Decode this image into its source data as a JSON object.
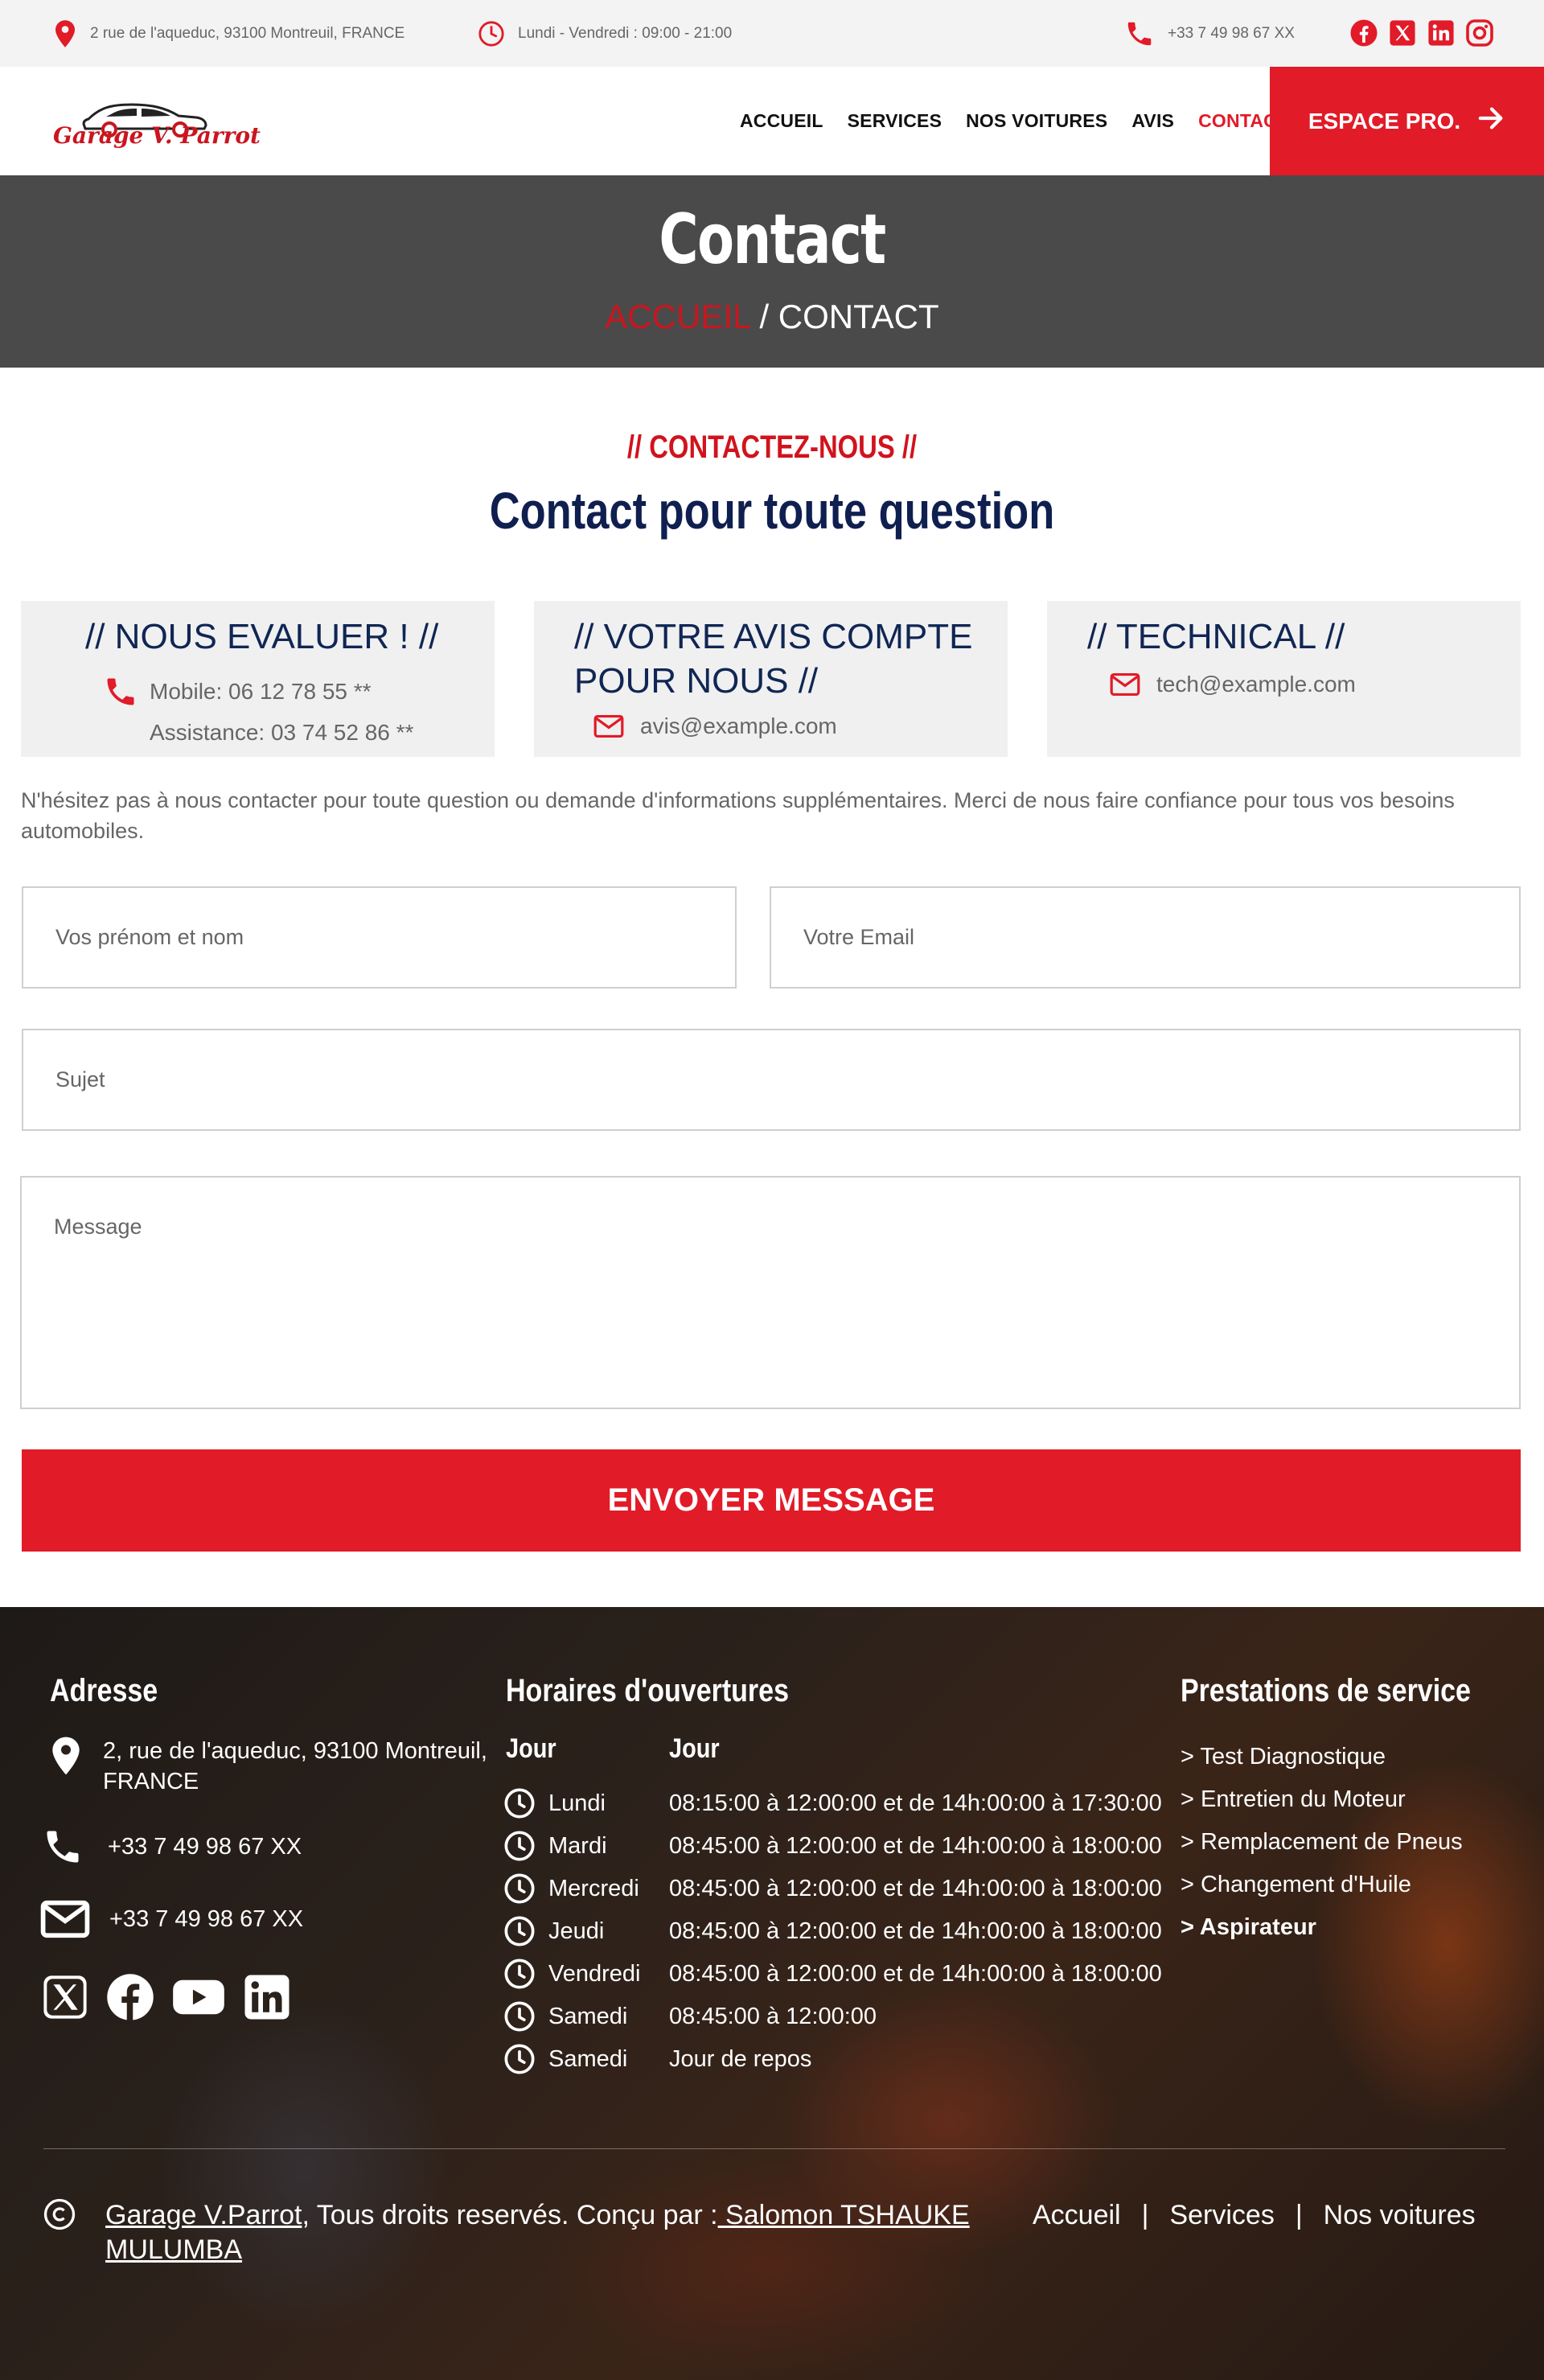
{
  "topbar": {
    "address": "2 rue de l'aqueduc, 93100 Montreuil, FRANCE",
    "hours": "Lundi - Vendredi : 09:00 - 21:00",
    "phone": "+33 7 49 98 67 XX",
    "social_icons": [
      "facebook-icon",
      "x-icon",
      "linkedin-icon",
      "instagram-icon"
    ]
  },
  "header": {
    "logo_text": "Garage V. Parrot",
    "nav": [
      "ACCUEIL",
      "SERVICES",
      "NOS VOITURES",
      "AVIS",
      "CONTACT"
    ],
    "active_nav": "CONTACT",
    "cta": "ESPACE PRO."
  },
  "banner": {
    "title": "Contact",
    "breadcrumb_home": "ACCUEIL",
    "breadcrumb_current": " / CONTACT"
  },
  "section": {
    "kicker": "// CONTACTEZ-NOUS //",
    "heading": "Contact pour toute question"
  },
  "cards": [
    {
      "title": "// NOUS EVALUER ! //",
      "lines": [
        "Mobile: 06 12 78 55 **",
        "Assistance: 03 74 52 86 **"
      ]
    },
    {
      "title_line1": "// VOTRE AVIS COMPTE",
      "title_line2": "POUR NOUS //",
      "email": "avis@example.com"
    },
    {
      "title": "// TECHNICAL //",
      "email": "tech@example.com"
    }
  ],
  "intro": "N'hésitez pas à nous contacter pour toute question ou demande d'informations supplémentaires. Merci de nous faire confiance pour tous vos besoins automobiles.",
  "form": {
    "name_placeholder": "Vos prénom et nom",
    "email_placeholder": "Votre Email",
    "subject_placeholder": "Sujet",
    "message_placeholder": "Message",
    "submit": "ENVOYER MESSAGE"
  },
  "footer": {
    "address_title": "Adresse",
    "address_line1": "2, rue de l'aqueduc, 93100 Montreuil,",
    "address_line2": "FRANCE",
    "phone": "+33 7 49 98 67 XX",
    "email_line": "+33 7 49 98 67 XX",
    "social_icons": [
      "x-icon",
      "facebook-icon",
      "youtube-icon",
      "linkedin-icon"
    ],
    "hours_title": "Horaires d'ouvertures",
    "col_day": "Jour",
    "col_hours": "Jour",
    "hours": [
      {
        "day": "Lundi",
        "hours": "08:15:00 à 12:00:00 et de 14h:00:00 à 17:30:00"
      },
      {
        "day": "Mardi",
        "hours": "08:45:00 à 12:00:00 et de 14h:00:00 à 18:00:00"
      },
      {
        "day": "Mercredi",
        "hours": "08:45:00 à 12:00:00 et de 14h:00:00 à 18:00:00"
      },
      {
        "day": "Jeudi",
        "hours": "08:45:00 à 12:00:00 et de 14h:00:00 à 18:00:00"
      },
      {
        "day": "Vendredi",
        "hours": "08:45:00 à 12:00:00 et de 14h:00:00 à 18:00:00"
      },
      {
        "day": "Samedi",
        "hours": "08:45:00 à 12:00:00"
      },
      {
        "day": "Samedi",
        "hours": "Jour de repos"
      }
    ],
    "services_title": "Prestations de service",
    "services": [
      "> Test Diagnostique",
      "> Entretien du Moteur",
      "> Remplacement de Pneus",
      "> Changement d'Huile",
      "> Aspirateur"
    ],
    "copyright_brand": "Garage V.Parrot",
    "copyright_text": ", Tous droits reservés. Conçu par :",
    "designer_line1": " Salomon TSHAUKE ",
    "designer_line2": "MULUMBA",
    "links": [
      "Accueil",
      "Services",
      "Nos voitures"
    ],
    "separator": "|"
  },
  "colors": {
    "accent": "#e11b28",
    "navy": "#0f1f4f",
    "banner": "#4a4a4a",
    "topbar": "#f3f3f3"
  }
}
